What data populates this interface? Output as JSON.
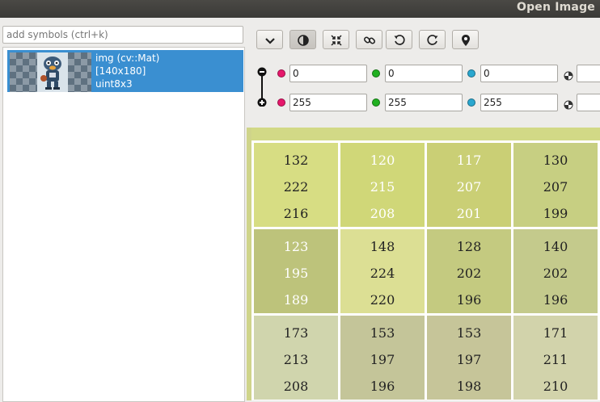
{
  "window": {
    "title": "Open Image"
  },
  "symbols": {
    "search_placeholder": "add symbols (ctrl+k)",
    "items": [
      {
        "name": "img (cv::Mat)",
        "dims": "[140x180]",
        "type": "uint8x3"
      }
    ]
  },
  "toolbar": {
    "buttons": [
      {
        "icon": "chevron-down-icon"
      },
      {
        "icon": "contrast-icon"
      },
      {
        "icon": "fit-icon"
      },
      {
        "icon": "link-icon"
      },
      {
        "icon": "rotate-ccw-icon"
      },
      {
        "icon": "rotate-cw-icon"
      },
      {
        "icon": "location-pin-icon"
      }
    ]
  },
  "contrast": {
    "min": {
      "r": "0",
      "g": "0",
      "b": "0"
    },
    "max": {
      "r": "255",
      "g": "255",
      "b": "255"
    },
    "colors": {
      "r": "#e6176b",
      "g": "#20b020",
      "b": "#2aa7cf"
    }
  },
  "pixels": {
    "rows": [
      {
        "cells": [
          {
            "values": [
              "132",
              "222",
              "216"
            ],
            "color": "#d7dd83",
            "text": "#222222"
          },
          {
            "values": [
              "120",
              "215",
              "208"
            ],
            "color": "#d0d778",
            "text": "#ffffff"
          },
          {
            "values": [
              "117",
              "207",
              "201"
            ],
            "color": "#cacf75",
            "text": "#ffffff"
          },
          {
            "values": [
              "130",
              "207",
              "199"
            ],
            "color": "#c7cf82",
            "text": "#222222"
          }
        ]
      },
      {
        "cells": [
          {
            "values": [
              "123",
              "195",
              "189"
            ],
            "color": "#bdc37b",
            "text": "#ffffff"
          },
          {
            "values": [
              "148",
              "224",
              "220"
            ],
            "color": "#dcdf94",
            "text": "#222222"
          },
          {
            "values": [
              "128",
              "202",
              "196"
            ],
            "color": "#c4ca80",
            "text": "#222222"
          },
          {
            "values": [
              "140",
              "202",
              "196"
            ],
            "color": "#c4ca8c",
            "text": "#222222"
          }
        ]
      },
      {
        "cells": [
          {
            "values": [
              "173",
              "213",
              "208"
            ],
            "color": "#d0d5ad",
            "text": "#222222"
          },
          {
            "values": [
              "153",
              "197",
              "196"
            ],
            "color": "#c4c599",
            "text": "#222222"
          },
          {
            "values": [
              "153",
              "197",
              "198"
            ],
            "color": "#c6c599",
            "text": "#222222"
          },
          {
            "values": [
              "171",
              "211",
              "210"
            ],
            "color": "#d2d3ab",
            "text": "#222222"
          }
        ]
      }
    ]
  }
}
